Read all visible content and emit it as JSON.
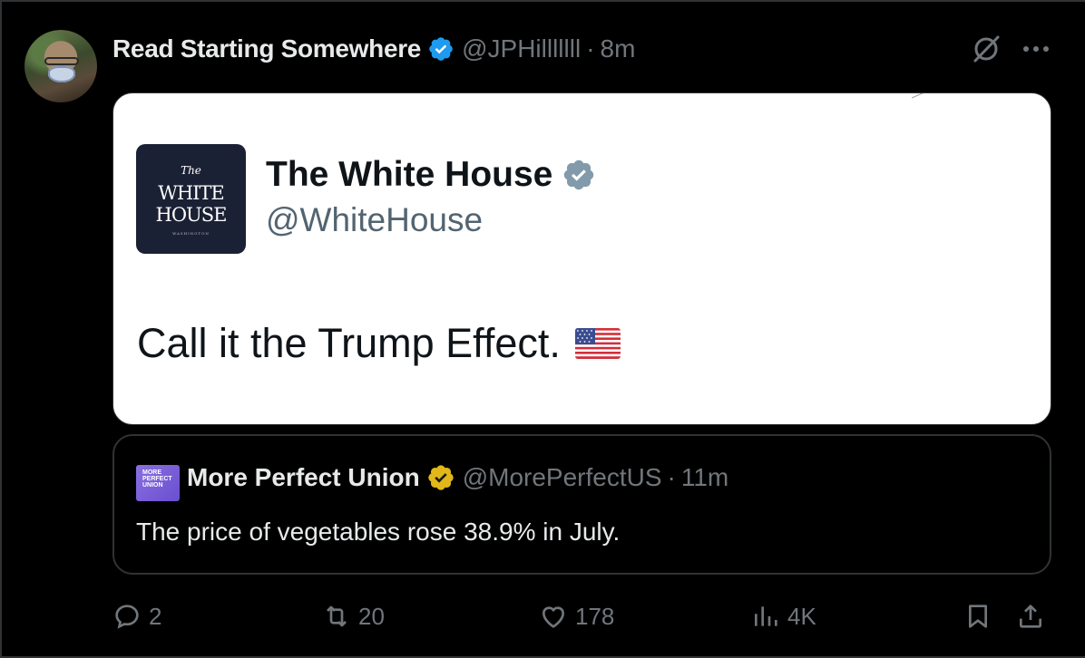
{
  "author": {
    "name": "Read Starting Somewhere",
    "handle": "@JPHilllllll",
    "separator": "·",
    "time": "8m",
    "verified_color": "#1d9bf0"
  },
  "media": {
    "account_name": "The White House",
    "account_handle": "@WhiteHouse",
    "logo": {
      "the": "The",
      "line1": "WHITE",
      "line2": "HOUSE",
      "sub": "WASHINGTON"
    },
    "text": "Call it the Trump Effect.",
    "flag_icon": "us-flag-icon",
    "verified_color": "#829aab"
  },
  "quote": {
    "avatar_text": "MORE PERFECT UNION",
    "name": "More Perfect Union",
    "handle": "@MorePerfectUS",
    "separator": "·",
    "time": "11m",
    "text": "The price of vegetables rose 38.9% in July.",
    "verified_color": "#e2b719"
  },
  "actions": {
    "replies": "2",
    "reposts": "20",
    "likes": "178",
    "views": "4K"
  },
  "colors": {
    "background": "#000000",
    "text": "#e7e9ea",
    "muted": "#71767b",
    "border": "#2f3336"
  }
}
